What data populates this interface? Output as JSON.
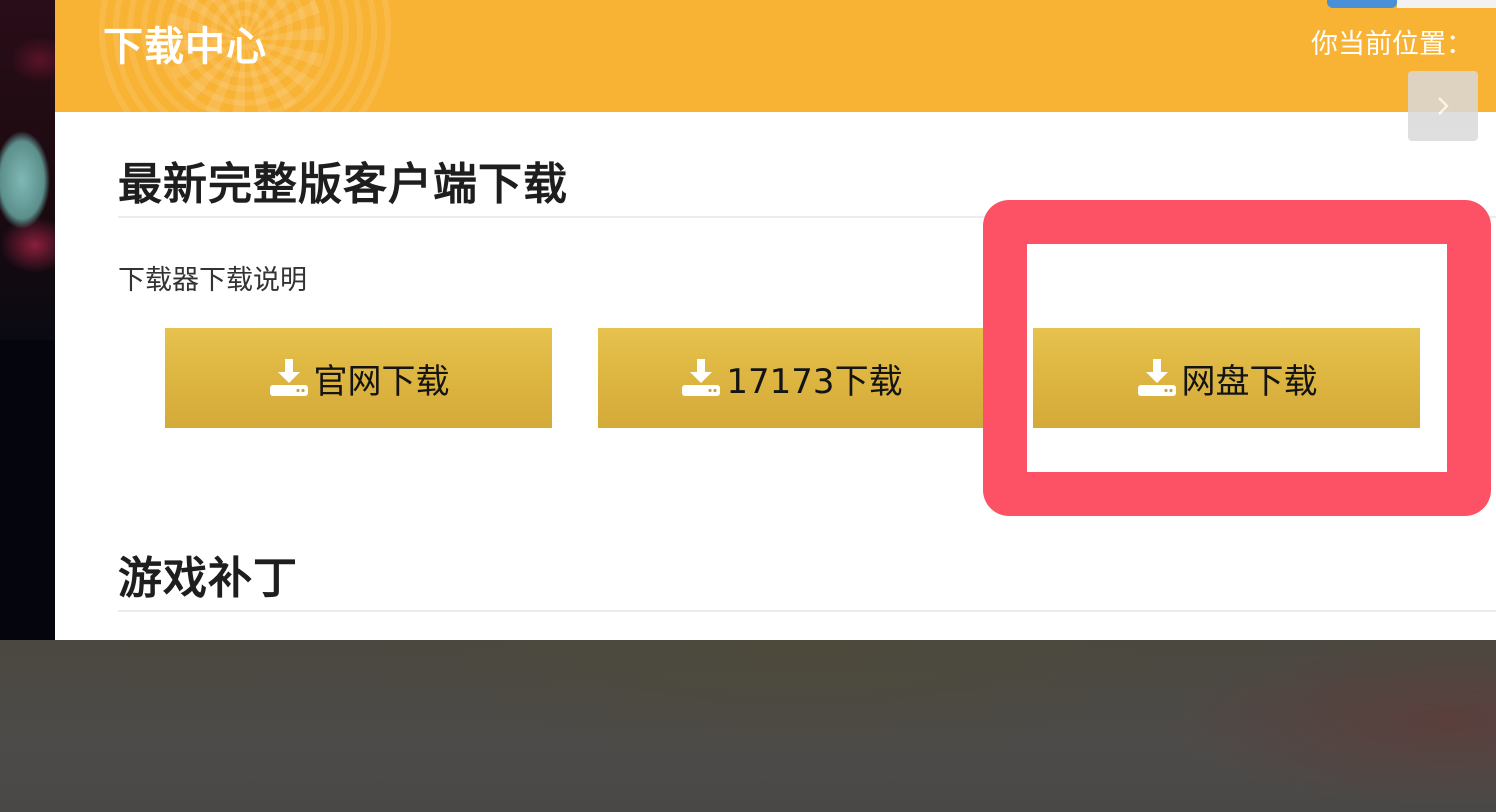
{
  "header": {
    "title": "下载中心",
    "location_label": "你当前位置：",
    "next_icon": "chevron-right-icon"
  },
  "sections": {
    "client": {
      "title": "最新完整版客户端下载",
      "note": "下载器下载说明",
      "buttons": [
        {
          "label": "官网下载",
          "icon": "download-icon"
        },
        {
          "label": "17173下载",
          "icon": "download-icon"
        },
        {
          "label": "网盘下载",
          "icon": "download-icon"
        }
      ]
    },
    "patch": {
      "title": "游戏补丁"
    }
  },
  "colors": {
    "header_bg": "#f8b234",
    "button_gold": "#dcb43f",
    "highlight": "#fd5165",
    "title_text": "#1e1e1e"
  }
}
